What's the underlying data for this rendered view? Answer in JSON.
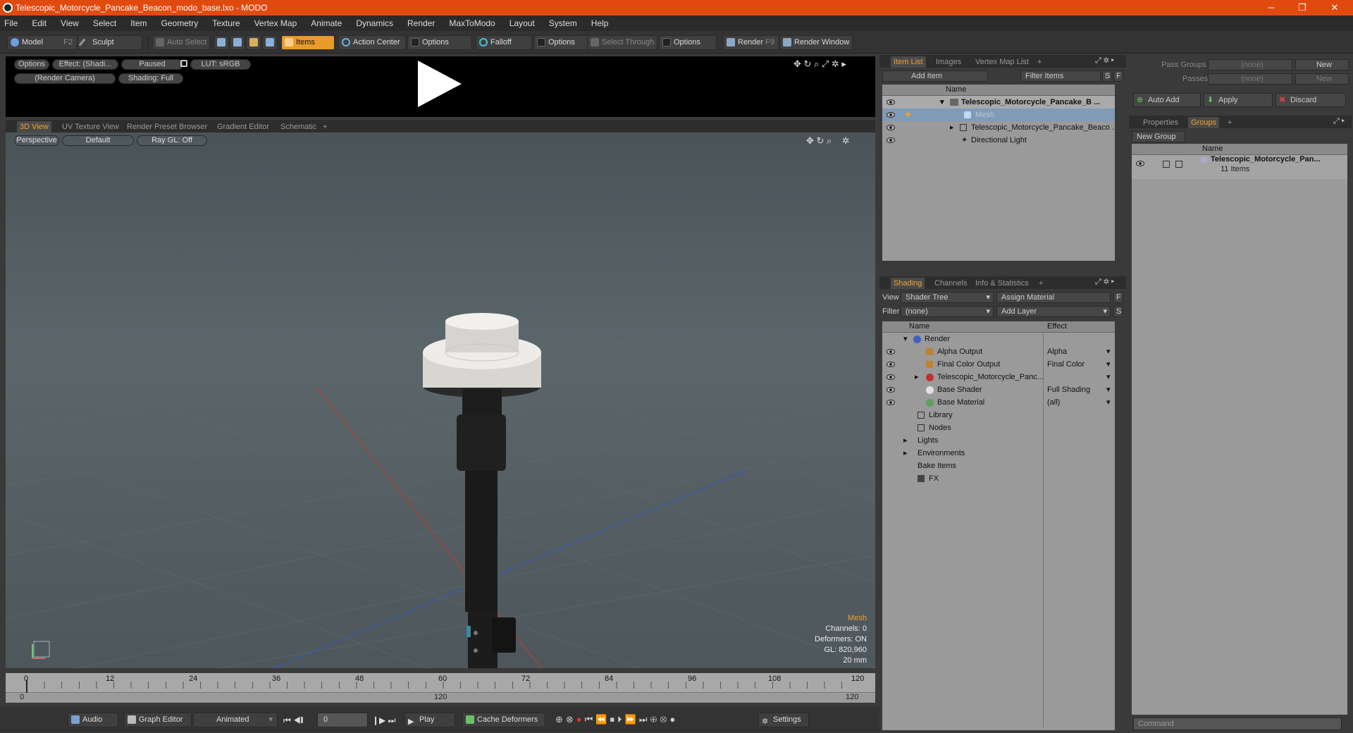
{
  "window": {
    "title": "Telescopic_Motorcycle_Pancake_Beacon_modo_base.lxo - MODO",
    "minimize": "─",
    "maximize": "❐",
    "close": "✕"
  },
  "menu": [
    "File",
    "Edit",
    "View",
    "Select",
    "Item",
    "Geometry",
    "Texture",
    "Vertex Map",
    "Animate",
    "Dynamics",
    "Render",
    "MaxToModo",
    "Layout",
    "System",
    "Help"
  ],
  "toolbar": {
    "model": "Model",
    "model_key": "F2",
    "sculpt": "Sculpt",
    "auto_select": "Auto Select",
    "items": "Items",
    "action_center": "Action Center",
    "options1": "Options",
    "falloff": "Falloff",
    "options2": "Options",
    "select_through": "Select Through",
    "options3": "Options",
    "render": "Render",
    "render_key": "F9",
    "render_window": "Render Window"
  },
  "preview": {
    "options": "Options",
    "effect": "Effect: (Shadi...",
    "paused": "Paused",
    "lut": "LUT: sRGB",
    "camera": "(Render Camera)",
    "shading": "Shading: Full"
  },
  "viewport_tabs": [
    "3D View",
    "UV Texture View",
    "Render Preset Browser",
    "Gradient Editor",
    "Schematic",
    "+"
  ],
  "viewport": {
    "perspective": "Perspective",
    "default": "Default",
    "raygl": "Ray GL: Off",
    "info_title": "Mesh",
    "info_lines": [
      "Channels: 0",
      "Deformers: ON",
      "GL: 820,960",
      "20 mm"
    ]
  },
  "timeline": {
    "ticks": [
      "0",
      "12",
      "24",
      "36",
      "48",
      "60",
      "72",
      "84",
      "96",
      "108",
      "120"
    ],
    "lower_start": "0",
    "lower_mid": "120",
    "lower_end": "120"
  },
  "bottom": {
    "audio": "Audio",
    "graph_editor": "Graph Editor",
    "animated": "Animated",
    "frame": "0",
    "play": "Play",
    "cache_deformers": "Cache Deformers",
    "settings": "Settings"
  },
  "item_list": {
    "tabs": [
      "Item List",
      "Images",
      "Vertex Map List",
      "+"
    ],
    "add_item": "Add Item",
    "filter_items": "Filter Items",
    "s": "S",
    "f": "F",
    "col_name": "Name",
    "rows": [
      "Telescopic_Motorcycle_Pancake_B ...",
      "Mesh",
      "Telescopic_Motorcycle_Pancake_Beaco ...",
      "Directional Light"
    ]
  },
  "shading": {
    "tabs": [
      "Shading",
      "Channels",
      "Info & Statistics",
      "+"
    ],
    "view_label": "View",
    "view_value": "Shader Tree",
    "assign_material": "Assign Material",
    "filter_label": "Filter",
    "filter_value": "(none)",
    "add_layer": "Add Layer",
    "f": "F",
    "s": "S",
    "col_name": "Name",
    "col_effect": "Effect",
    "rows": [
      {
        "name": "Render",
        "effect": ""
      },
      {
        "name": "Alpha Output",
        "effect": "Alpha"
      },
      {
        "name": "Final Color Output",
        "effect": "Final Color"
      },
      {
        "name": "Telescopic_Motorcycle_Panc...",
        "effect": ""
      },
      {
        "name": "Base Shader",
        "effect": "Full Shading"
      },
      {
        "name": "Base Material",
        "effect": "(all)"
      },
      {
        "name": "Library",
        "effect": ""
      },
      {
        "name": "Nodes",
        "effect": ""
      },
      {
        "name": "Lights",
        "effect": ""
      },
      {
        "name": "Environments",
        "effect": ""
      },
      {
        "name": "Bake Items",
        "effect": ""
      },
      {
        "name": "FX",
        "effect": ""
      }
    ]
  },
  "right": {
    "pass_groups": "Pass Groups",
    "passes": "Passes",
    "none1": "(none)",
    "none2": "(none)",
    "new1": "New",
    "new2": "New",
    "auto_add": "Auto Add",
    "apply": "Apply",
    "discard": "Discard",
    "tabs": [
      "Properties",
      "Groups",
      "+"
    ],
    "new_group": "New Group",
    "col_name": "Name",
    "group_name": "Telescopic_Motorcycle_Pan...",
    "group_count": "11 Items",
    "command_placeholder": "Command"
  }
}
